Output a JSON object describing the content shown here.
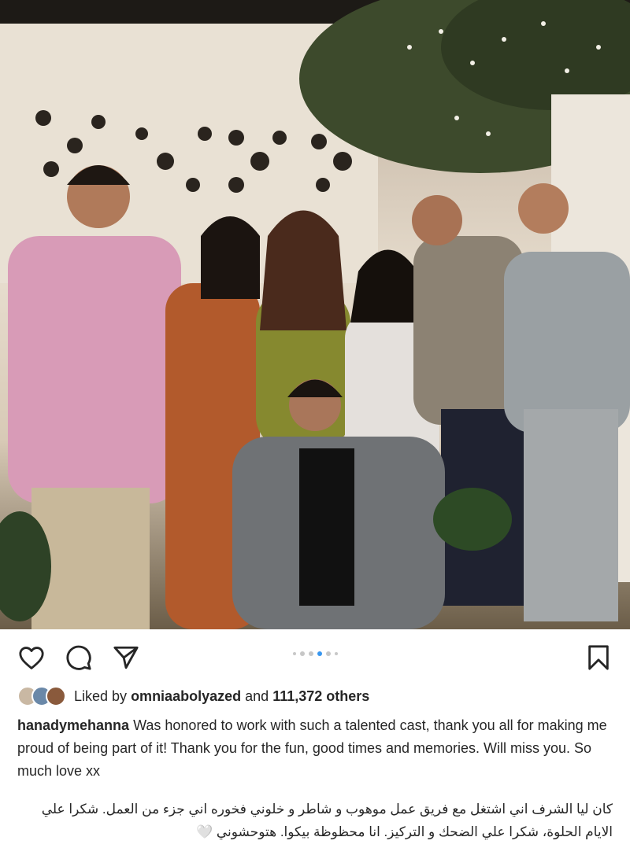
{
  "post": {
    "photo_alt": "",
    "carousel": {
      "count": 6,
      "active_index": 3
    },
    "actions": {
      "like_icon": "heart-icon",
      "comment_icon": "comment-icon",
      "share_icon": "send-icon",
      "save_icon": "bookmark-icon"
    },
    "likes": {
      "prefix": "Liked by",
      "user": "omniaabolyazed",
      "connector": "and",
      "others": "111,372 others"
    },
    "caption": {
      "username": "hanadymehanna",
      "text": "Was honored to work with such a talented cast, thank you all for making me proud of being part of it! Thank you for the fun, good times and memories. Will miss you. So much love xx",
      "arabic": "كان ليا الشرف اني اشتغل مع فريق عمل  موهوب و شاطر و خلوني فخوره اني جزء من العمل. شكرا علي الايام الحلوة، شكرا علي الضحك و التركيز. انا محظوظة بيكوا. هتوحشوني 🤍"
    }
  }
}
